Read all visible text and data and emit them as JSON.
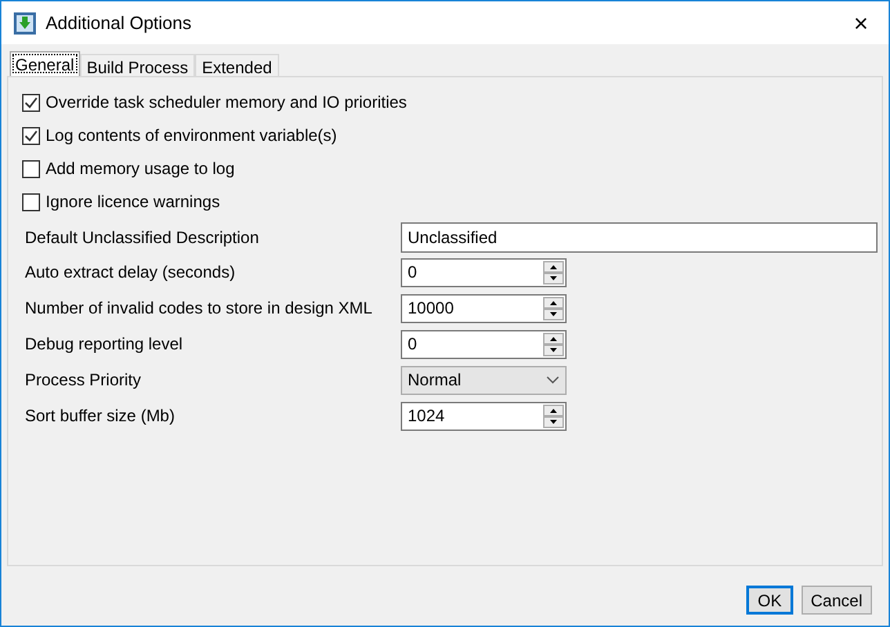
{
  "window": {
    "title": "Additional Options",
    "close": "×"
  },
  "tabs": [
    {
      "label": "General",
      "selected": true
    },
    {
      "label": "Build Process",
      "selected": false
    },
    {
      "label": "Extended",
      "selected": false
    }
  ],
  "checkboxes": [
    {
      "label": "Override task scheduler memory and IO priorities",
      "checked": true
    },
    {
      "label": "Log contents of environment variable(s)",
      "checked": true
    },
    {
      "label": "Add memory usage to log",
      "checked": false
    },
    {
      "label": "Ignore licence warnings",
      "checked": false
    }
  ],
  "fields": [
    {
      "label": "Default Unclassified Description",
      "kind": "text",
      "value": "Unclassified"
    },
    {
      "label": "Auto extract delay (seconds)",
      "kind": "spin",
      "value": "0"
    },
    {
      "label": "Number of invalid codes to store in design XML",
      "kind": "spin",
      "value": "10000"
    },
    {
      "label": "Debug reporting level",
      "kind": "spin",
      "value": "0"
    },
    {
      "label": "Process Priority",
      "kind": "select",
      "value": "Normal"
    },
    {
      "label": "Sort buffer size (Mb)",
      "kind": "spin",
      "value": "1024"
    }
  ],
  "buttons": [
    {
      "label": "OK",
      "default": true
    },
    {
      "label": "Cancel",
      "default": false
    }
  ]
}
